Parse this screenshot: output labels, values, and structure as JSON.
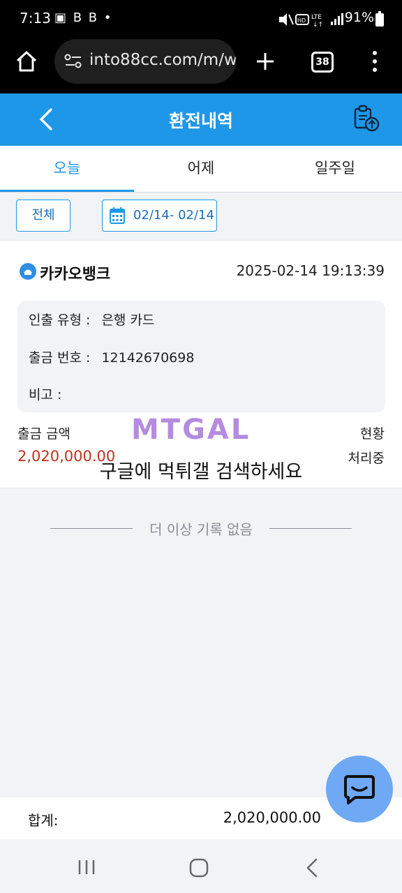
{
  "status_bar": {
    "time": "7:13",
    "left_icons": "▣ B B •",
    "right": "91%"
  },
  "browser": {
    "url": "into88cc.com/m/w",
    "tab_count": "38"
  },
  "header": {
    "title": "환전내역"
  },
  "tabs": [
    {
      "label": "오늘",
      "active": true
    },
    {
      "label": "어제",
      "active": false
    },
    {
      "label": "일주일",
      "active": false
    }
  ],
  "filter": {
    "all_label": "전체",
    "date_range": "02/14- 02/14"
  },
  "record": {
    "bank_name": "카카오뱅크",
    "datetime": "2025-02-14 19:13:39",
    "withdraw_type_label": "인출 유형 :",
    "withdraw_type_value": "은행 카드",
    "withdraw_no_label": "출금 번호 :",
    "withdraw_no_value": "12142670698",
    "note_label": "비고 :",
    "amount_label": "출금 금액",
    "amount_value": "2,020,000.00",
    "status_label": "현황",
    "status_value": "처리중"
  },
  "watermark": {
    "logo_text": "MTGAL",
    "overlay_text": "구글에 먹튀갤 검색하세요"
  },
  "list_end": "더 이상 기록 없음",
  "total": {
    "label": "합계:",
    "value": "2,020,000.00"
  },
  "colors": {
    "header": "#1e97e8",
    "amount": "#c0321e",
    "chat_fab": "#6fa8f5"
  }
}
